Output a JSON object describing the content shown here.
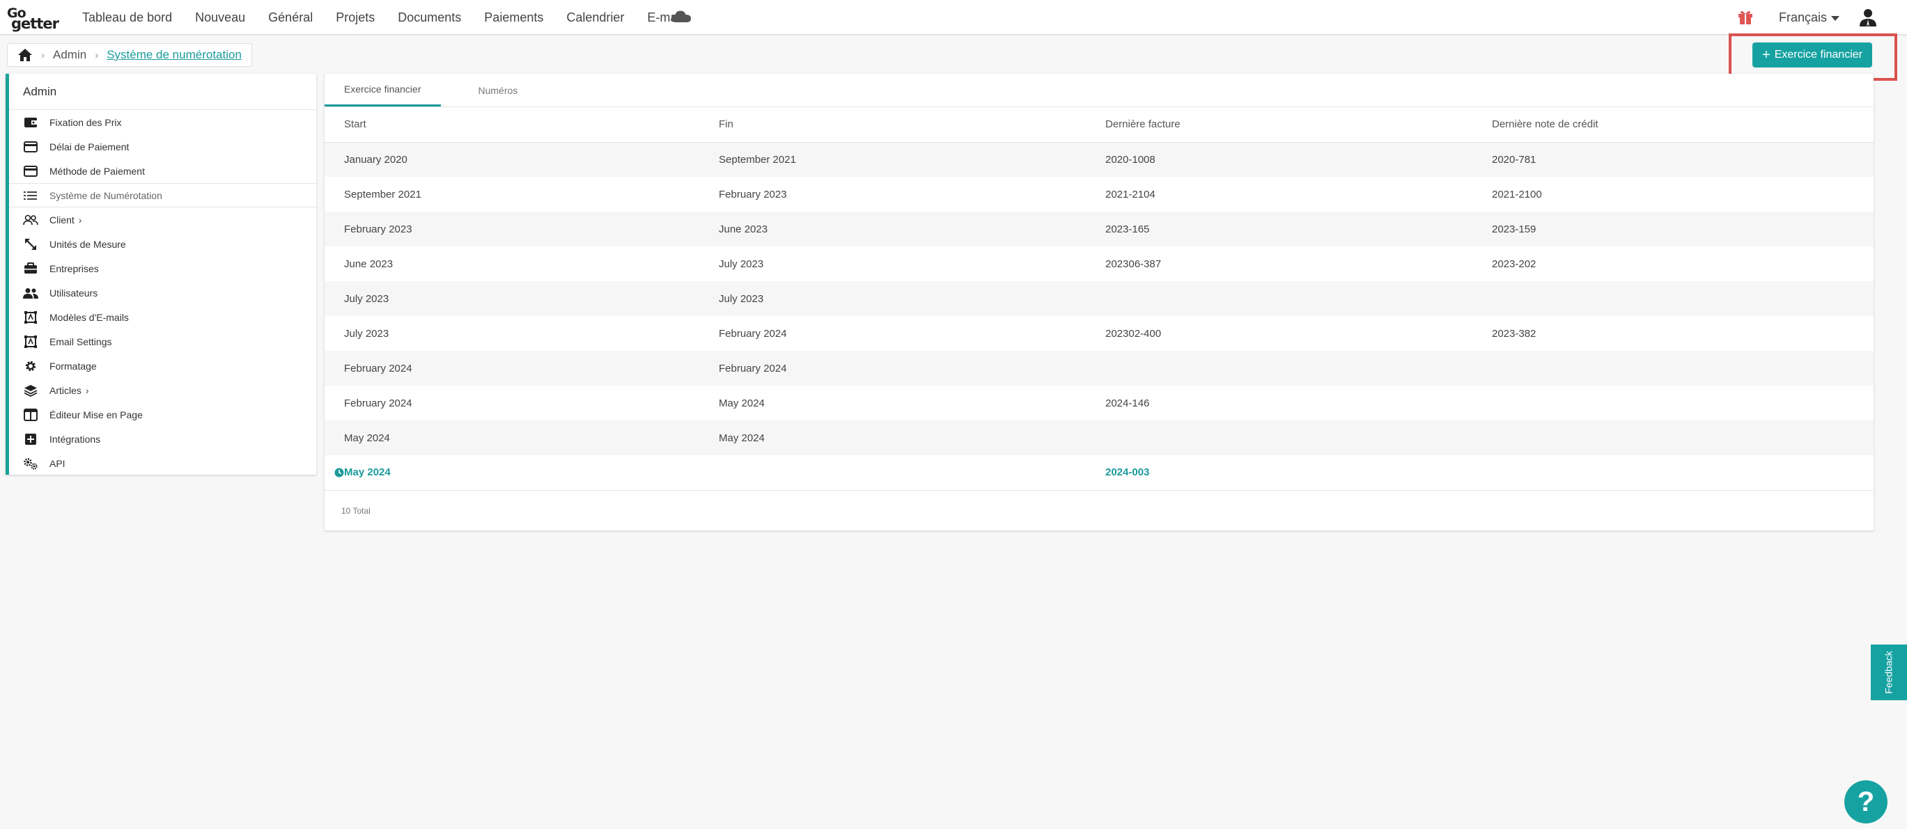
{
  "brand": {
    "logo_top": "Go",
    "logo_bottom": "getter"
  },
  "nav": {
    "items": [
      {
        "label": "Tableau de bord"
      },
      {
        "label": "Nouveau"
      },
      {
        "label": "Général"
      },
      {
        "label": "Projets"
      },
      {
        "label": "Documents"
      },
      {
        "label": "Paiements"
      },
      {
        "label": "Calendrier"
      },
      {
        "label": "E-mail"
      }
    ],
    "cloud_icon": "cloud-icon",
    "gift_icon": "gift-icon",
    "language": "Français",
    "user_icon": "user-icon"
  },
  "breadcrumb": {
    "home_icon": "home-icon",
    "admin": "Admin",
    "current": "Système de numérotation"
  },
  "actions": {
    "add_fiscal_year": "Exercice financier"
  },
  "sidebar": {
    "title": "Admin",
    "items": [
      {
        "label": "Fixation des Prix",
        "icon": "wallet-icon"
      },
      {
        "label": "Délai de Paiement",
        "icon": "credit-card-icon"
      },
      {
        "label": "Méthode de Paiement",
        "icon": "credit-card-icon"
      },
      {
        "label": "Système de Numérotation",
        "icon": "list-icon",
        "active": true
      },
      {
        "label": "Client",
        "icon": "users-icon",
        "chevron": "›"
      },
      {
        "label": "Unités de Mesure",
        "icon": "resize-icon"
      },
      {
        "label": "Entreprises",
        "icon": "briefcase-icon"
      },
      {
        "label": "Utilisateurs",
        "icon": "people-icon"
      },
      {
        "label": "Modèles d'E-mails",
        "icon": "template-icon"
      },
      {
        "label": "Email Settings",
        "icon": "template-icon"
      },
      {
        "label": "Formatage",
        "icon": "gear-icon"
      },
      {
        "label": "Articles",
        "icon": "layers-icon",
        "chevron": "›"
      },
      {
        "label": "Éditeur Mise en Page",
        "icon": "layout-icon"
      },
      {
        "label": "Intégrations",
        "icon": "plus-square-icon"
      },
      {
        "label": "API",
        "icon": "gears-icon"
      }
    ]
  },
  "tabs": [
    {
      "label": "Exercice financier",
      "active": true
    },
    {
      "label": "Numéros"
    }
  ],
  "table": {
    "headers": [
      "Start",
      "Fin",
      "Dernière facture",
      "Dernière note de crédit"
    ],
    "rows": [
      [
        "January 2020",
        "September 2021",
        "2020-1008",
        "2020-781"
      ],
      [
        "September 2021",
        "February 2023",
        "2021-2104",
        "2021-2100"
      ],
      [
        "February 2023",
        "June 2023",
        "2023-165",
        "2023-159"
      ],
      [
        "June 2023",
        "July 2023",
        "202306-387",
        "2023-202"
      ],
      [
        "July 2023",
        "July 2023",
        "",
        ""
      ],
      [
        "July 2023",
        "February 2024",
        "202302-400",
        "2023-382"
      ],
      [
        "February 2024",
        "February 2024",
        "",
        ""
      ],
      [
        "February 2024",
        "May 2024",
        "2024-146",
        ""
      ],
      [
        "May 2024",
        "May 2024",
        "",
        ""
      ],
      [
        "May 2024",
        "",
        "2024-003",
        ""
      ]
    ],
    "current_row_icon": "clock-icon",
    "total": "10 Total"
  },
  "feedback": "Feedback",
  "help": "?",
  "colors": {
    "accent": "#17a2a2",
    "highlight": "#d9534f"
  }
}
